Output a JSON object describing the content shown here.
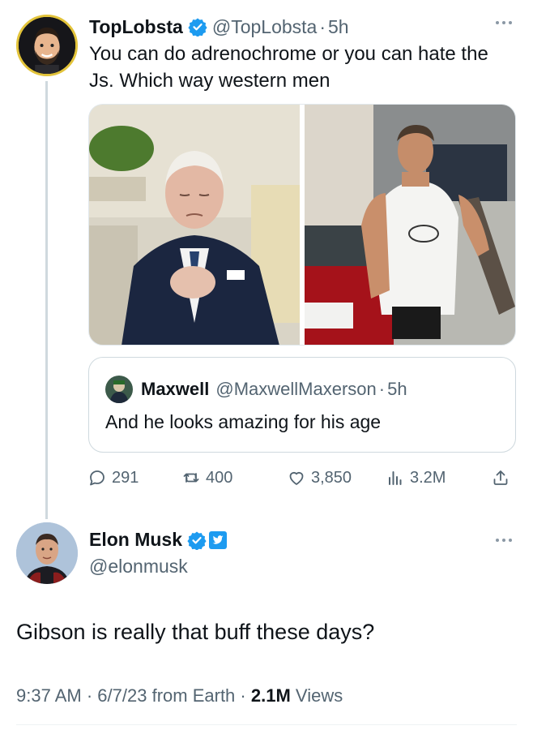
{
  "colors": {
    "verified_blue": "#1d9bf0",
    "secondary_text": "#536471",
    "primary_text": "#0f1419",
    "border": "#cfd9de"
  },
  "tweet": {
    "author_name": "TopLobsta",
    "author_handle": "@TopLobsta",
    "age": "5h",
    "text": "You can do adrenochrome or you can hate the Js. Which way western men",
    "more_icon": "more-horizontal-icon",
    "media": [
      {
        "alt": "photo-man-in-suit-eyes-closed"
      },
      {
        "alt": "photo-man-in-tank-top-street"
      }
    ],
    "quote": {
      "author_name": "Maxwell",
      "author_handle": "@MaxwellMaxerson",
      "age": "5h",
      "text": "And he looks amazing for his age"
    },
    "actions": {
      "replies": "291",
      "retweets": "400",
      "likes": "3,850",
      "views": "3.2M"
    }
  },
  "reply": {
    "author_name": "Elon Musk",
    "author_handle": "@elonmusk",
    "text": "Gibson is really that buff these days?",
    "time": "9:37 AM",
    "date": "6/7/23",
    "source": "from Earth",
    "views_count": "2.1M",
    "views_label": "Views"
  }
}
